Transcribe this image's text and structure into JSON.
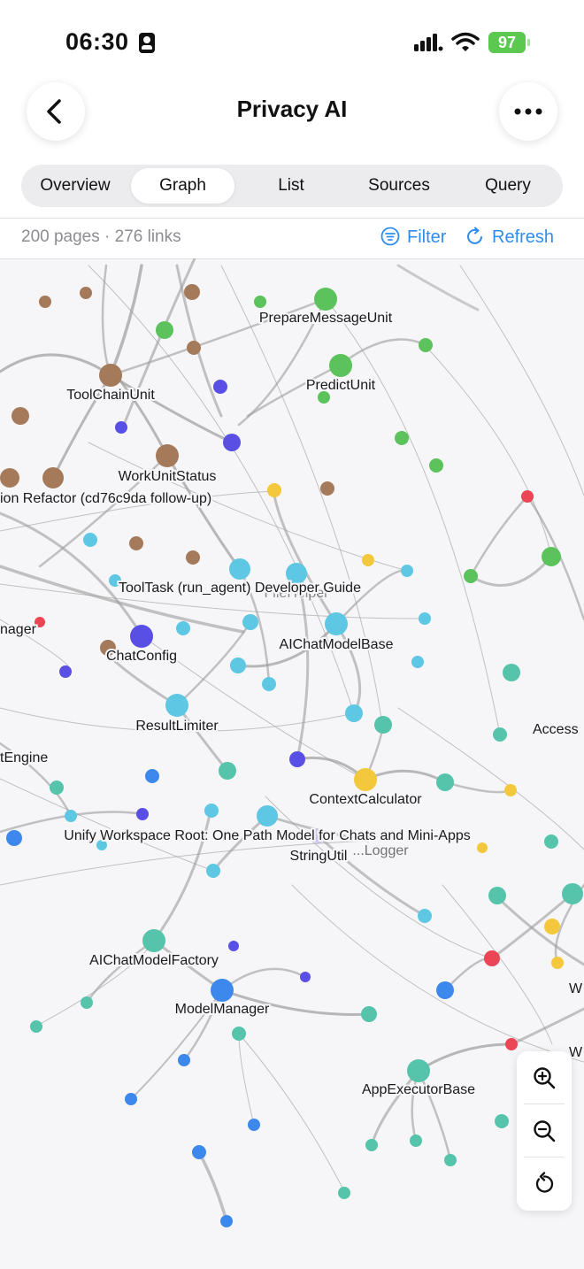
{
  "status_bar": {
    "time": "06:30",
    "battery": "97"
  },
  "nav": {
    "title": "Privacy AI"
  },
  "tabs": [
    "Overview",
    "Graph",
    "List",
    "Sources",
    "Query"
  ],
  "active_tab": "Graph",
  "info": {
    "counts": "200 pages · 276 links",
    "filter_label": "Filter",
    "refresh_label": "Refresh"
  },
  "colors": {
    "accent": "#2f8cf0",
    "brown": "#a57a5a",
    "green": "#5cc25c",
    "purple": "#5a4fe4",
    "blue": "#3d88ec",
    "cyan": "#5ec7e4",
    "teal": "#56c4ab",
    "yellow": "#f3c83c",
    "red": "#ea4656"
  },
  "graph": {
    "labels": [
      "PrepareMessageUnit",
      "PredictUnit",
      "ToolChainUnit",
      "WorkUnitStatus",
      "ion Refactor (cd76c9da follow-up)",
      "FileHelper",
      "ToolTask (run_agent) Developer Guide",
      "nager",
      "AIChatModelBase",
      "ChatConfig",
      "ResultLimiter",
      "Access",
      "tEngine",
      "ContextCalculator",
      "Unify Workspace Root: One Path Model for Chats and Mini-Apps",
      "...Logger",
      "StringUtil",
      "AIChatModelFactory",
      "W",
      "ModelManager",
      "W",
      "AppExecutorBase"
    ]
  }
}
